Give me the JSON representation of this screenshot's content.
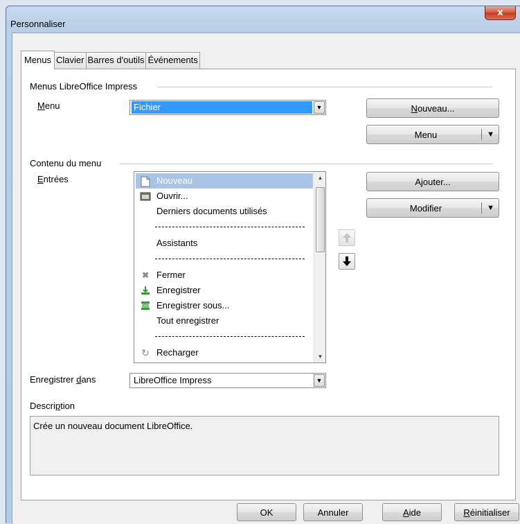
{
  "window": {
    "title": "Personnaliser",
    "close_glyph": "x"
  },
  "tabs": [
    {
      "label": "Menus",
      "active": true
    },
    {
      "label": "Clavier",
      "active": false
    },
    {
      "label": "Barres d'outils",
      "active": false
    },
    {
      "label": "Événements",
      "active": false
    }
  ],
  "menus_group": {
    "title": "Menus LibreOffice Impress",
    "menu_label_pre": "",
    "menu_label_u": "M",
    "menu_label_post": "enu",
    "menu_value": "Fichier",
    "new_button_u": "N",
    "new_button_rest": "ouveau...",
    "menu_button": "Menu"
  },
  "content_group": {
    "title": "Contenu du menu",
    "entries_label_u": "E",
    "entries_label_rest": "ntrées",
    "entries": [
      {
        "label": "Nouveau",
        "icon": "new-document-icon",
        "selected": true
      },
      {
        "label": "Ouvrir...",
        "icon": "open-folder-icon"
      },
      {
        "label": "Derniers documents utilisés",
        "icon": ""
      },
      {
        "label": "Assistants",
        "icon": ""
      },
      {
        "label": "Fermer",
        "icon": "close-x-icon"
      },
      {
        "label": "Enregistrer",
        "icon": "save-icon"
      },
      {
        "label": "Enregistrer sous...",
        "icon": "save-as-icon"
      },
      {
        "label": "Tout enregistrer",
        "icon": ""
      },
      {
        "label": "Recharger",
        "icon": "reload-icon"
      }
    ],
    "add_button": "Ajouter...",
    "modify_button": "Modifier",
    "save_in_label_pre": "Enregistrer ",
    "save_in_label_u": "d",
    "save_in_label_post": "ans",
    "save_in_value": "LibreOffice Impress"
  },
  "description": {
    "label_pre": "Descri",
    "label_u": "p",
    "label_post": "tion",
    "text": "Crée un nouveau document LibreOffice."
  },
  "footer": {
    "ok": "OK",
    "cancel": "Annuler",
    "help_u": "A",
    "help_rest": "ide",
    "reset_u": "R",
    "reset_rest": "éinitialiser"
  }
}
